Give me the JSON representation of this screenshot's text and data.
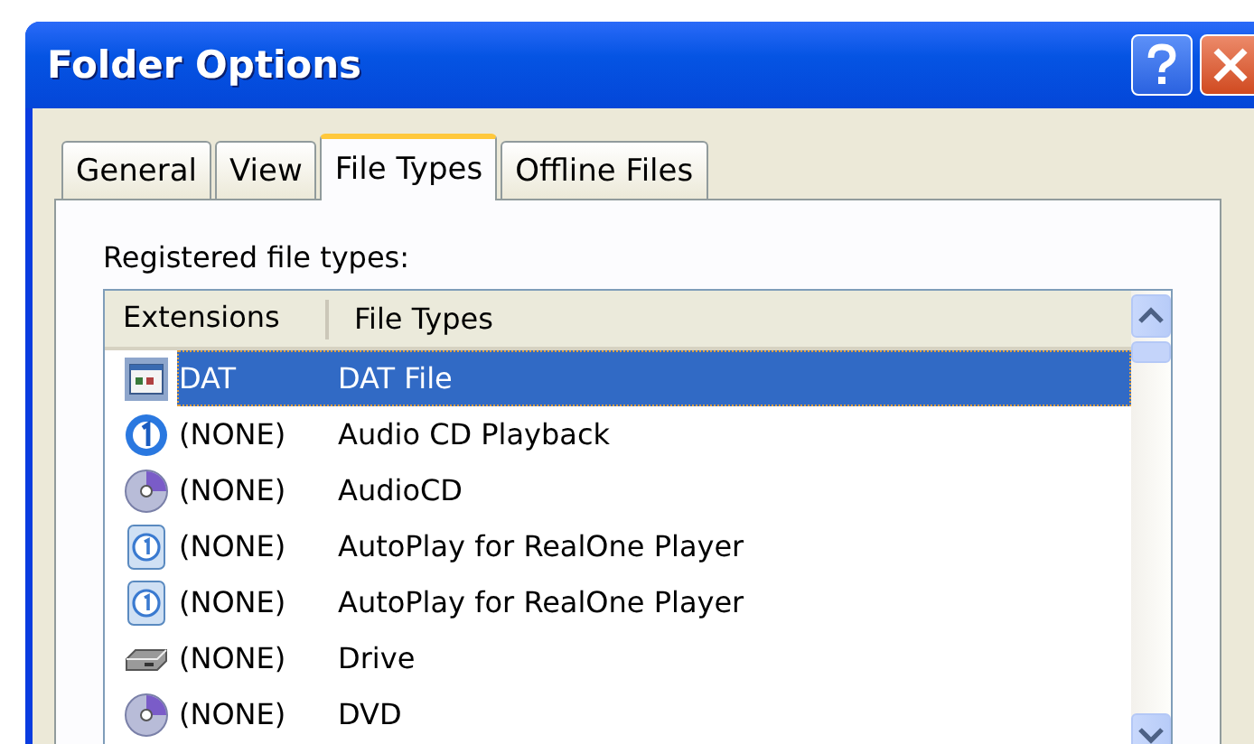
{
  "window": {
    "title": "Folder Options"
  },
  "tabs": [
    {
      "label": "General",
      "selected": false
    },
    {
      "label": "View",
      "selected": false
    },
    {
      "label": "File Types",
      "selected": true
    },
    {
      "label": "Offline Files",
      "selected": false
    }
  ],
  "list_label": "Registered file types:",
  "table": {
    "columns": [
      "Extensions",
      "File Types"
    ],
    "rows": [
      {
        "kind": "file",
        "extension": "DAT",
        "file_type": "DAT File",
        "selected": true
      },
      {
        "kind": "badge",
        "extension": "(NONE)",
        "file_type": "Audio CD Playback",
        "selected": false
      },
      {
        "kind": "disc",
        "extension": "(NONE)",
        "file_type": "AudioCD",
        "selected": false
      },
      {
        "kind": "tile",
        "extension": "(NONE)",
        "file_type": "AutoPlay for RealOne Player",
        "selected": false
      },
      {
        "kind": "tile",
        "extension": "(NONE)",
        "file_type": "AutoPlay for RealOne Player",
        "selected": false
      },
      {
        "kind": "drive",
        "extension": "(NONE)",
        "file_type": "Drive",
        "selected": false
      },
      {
        "kind": "disc",
        "extension": "(NONE)",
        "file_type": "DVD",
        "selected": false
      }
    ]
  }
}
